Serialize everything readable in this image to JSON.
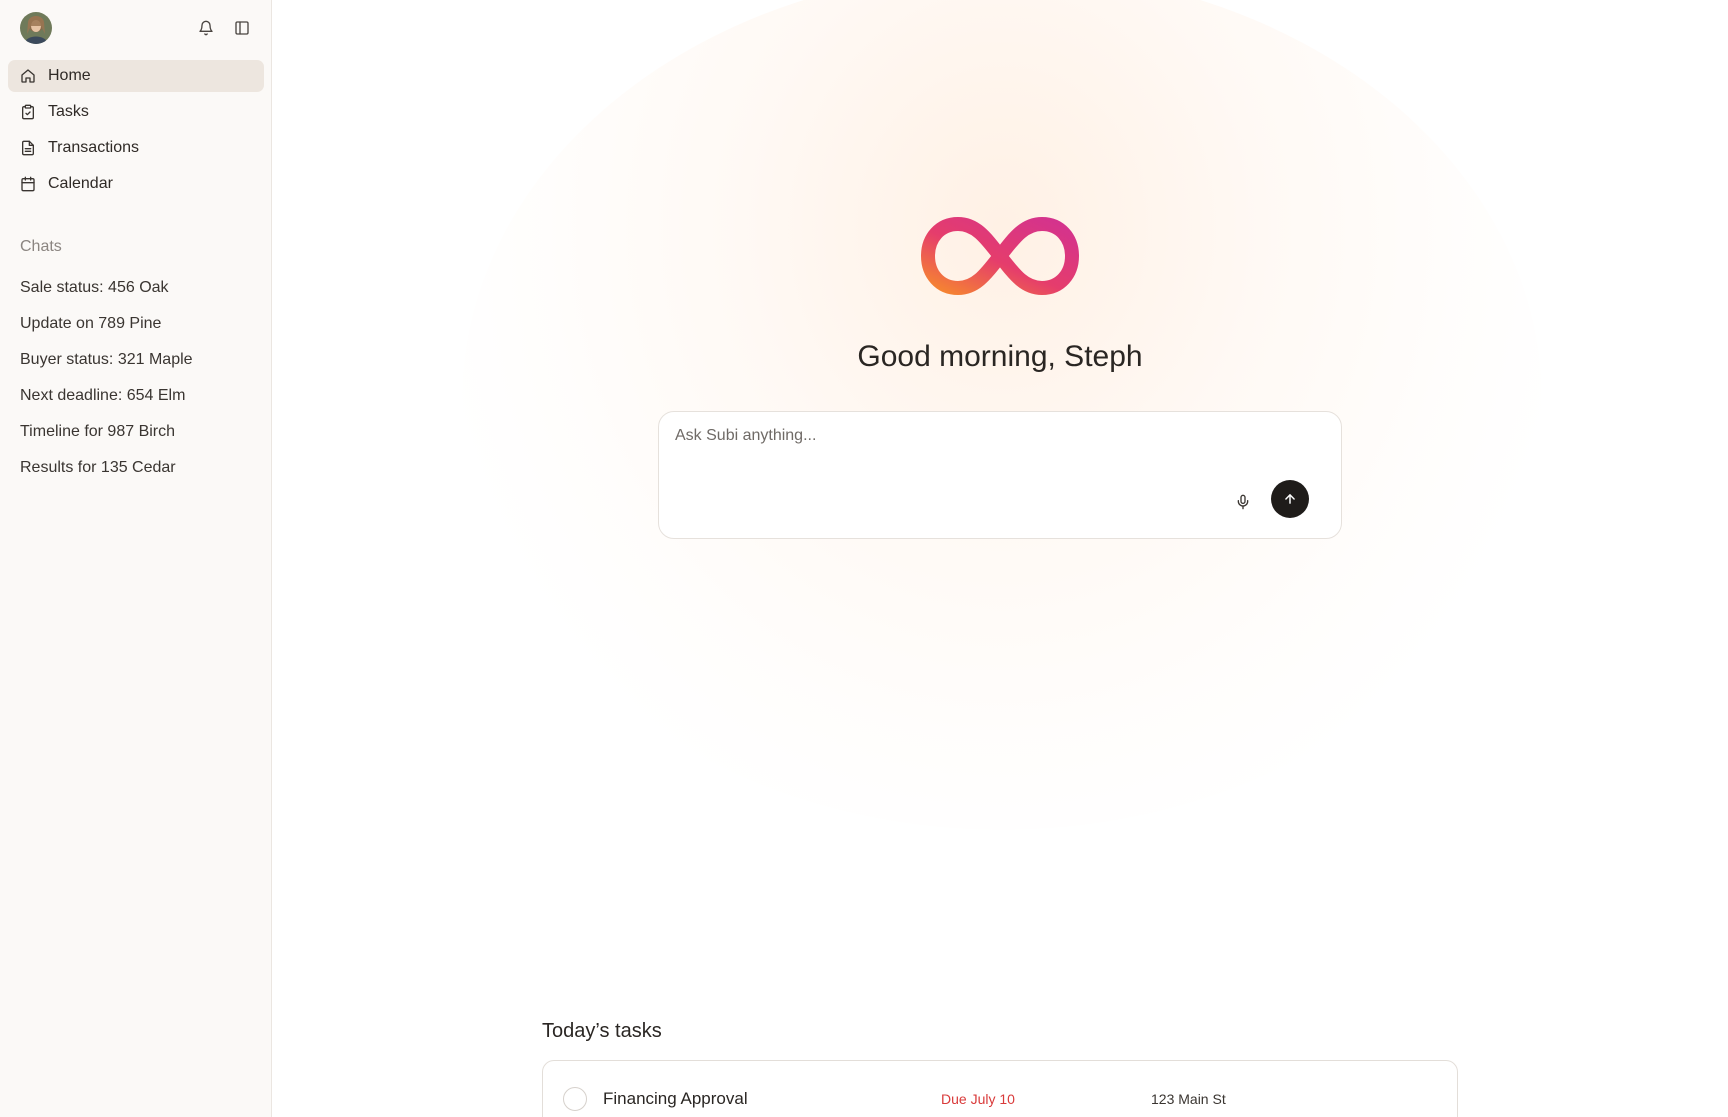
{
  "sidebar": {
    "avatar_alt": "User avatar",
    "nav": [
      {
        "label": "Home",
        "icon": "home-icon",
        "active": true
      },
      {
        "label": "Tasks",
        "icon": "clipboard-check-icon",
        "active": false
      },
      {
        "label": "Transactions",
        "icon": "document-icon",
        "active": false
      },
      {
        "label": "Calendar",
        "icon": "calendar-icon",
        "active": false
      }
    ],
    "chats_heading": "Chats",
    "chats": [
      "Sale status: 456 Oak",
      "Update on 789 Pine",
      "Buyer status: 321 Maple",
      "Next deadline: 654 Elm",
      "Timeline for 987 Birch",
      "Results for 135 Cedar"
    ]
  },
  "main": {
    "greeting": "Good morning, Steph",
    "ask": {
      "placeholder": "Ask Subi anything..."
    },
    "tasks_heading": "Today’s tasks",
    "tasks": [
      {
        "title": "Financing Approval",
        "due": "Due July 10",
        "address": "123 Main St"
      }
    ]
  },
  "colors": {
    "logo_gradient": [
      "#f47b35",
      "#e23b74",
      "#d6338f"
    ],
    "due_red": "#d93a3a",
    "active_nav_bg": "#ede6df",
    "send_button": "#1f1c1a"
  }
}
